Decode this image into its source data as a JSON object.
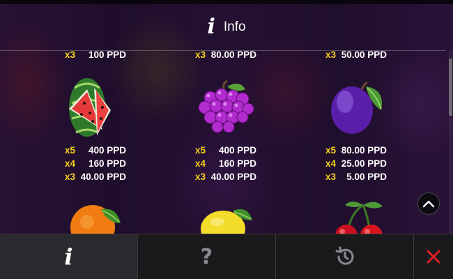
{
  "header": {
    "icon": "info-icon",
    "title": "Info"
  },
  "paytable": {
    "watermelon": {
      "top": {
        "mult": "x3",
        "value": "100 PPD"
      },
      "rows": [
        {
          "mult": "x5",
          "value": "400 PPD"
        },
        {
          "mult": "x4",
          "value": "160 PPD"
        },
        {
          "mult": "x3",
          "value": "40.00 PPD"
        }
      ]
    },
    "grapes": {
      "top": {
        "mult": "x3",
        "value": "80.00 PPD"
      },
      "rows": [
        {
          "mult": "x5",
          "value": "400 PPD"
        },
        {
          "mult": "x4",
          "value": "160 PPD"
        },
        {
          "mult": "x3",
          "value": "40.00 PPD"
        }
      ]
    },
    "plum": {
      "top": {
        "mult": "x3",
        "value": "50.00 PPD"
      },
      "rows": [
        {
          "mult": "x5",
          "value": "80.00 PPD"
        },
        {
          "mult": "x4",
          "value": "25.00 PPD"
        },
        {
          "mult": "x3",
          "value": "5.00 PPD"
        }
      ]
    },
    "bottom_symbols": [
      "orange-icon",
      "lemon-icon",
      "cherries-icon"
    ]
  },
  "toolbar": {
    "info_label": "i",
    "help_label": "?",
    "history_icon": "history-icon",
    "close_icon": "close-icon"
  },
  "colors": {
    "multiplier": "#f7d21a",
    "value": "#ffffff",
    "close": "#e02020",
    "toolbar_bg": "#1a1a1d"
  }
}
